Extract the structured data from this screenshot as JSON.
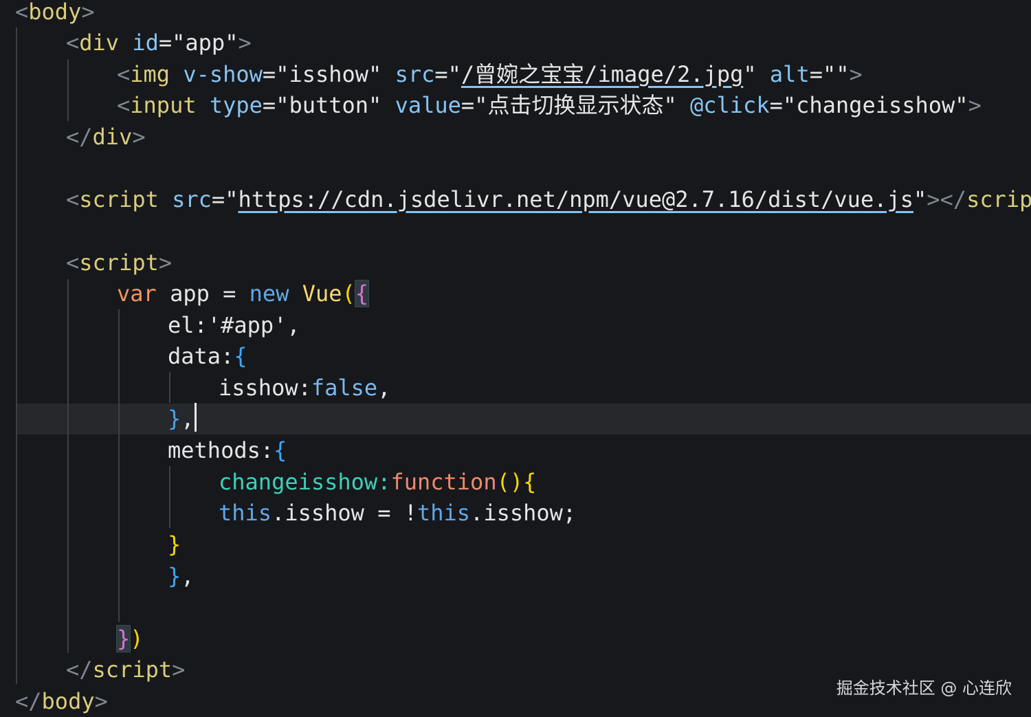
{
  "watermark": "掘金技术社区 @ 心连欣",
  "code": {
    "body_open_tag": "body",
    "div_tag": "div",
    "div_attr_id": "id",
    "div_id_value": "\"app\"",
    "img_tag": "img",
    "img_attr_vshow": "v-show",
    "img_vshow_value": "\"isshow\"",
    "img_attr_src": "src",
    "img_src_q1": "\"",
    "img_src_value": "/曾婉之宝宝/image/2.jpg",
    "img_src_q2": "\"",
    "img_attr_alt": "alt",
    "img_alt_value": "\"\"",
    "input_tag": "input",
    "input_attr_type": "type",
    "input_type_value": "\"button\"",
    "input_attr_value": "value",
    "input_value_value": "\"点击切换显示状态\"",
    "input_attr_click": "@click",
    "input_click_value": "\"changeisshow\"",
    "div_close_tag": "div",
    "script1_tag": "script",
    "script1_attr_src": "src",
    "script1_src_q1": "\"",
    "script1_src_value": "https://cdn.jsdelivr.net/npm/vue@2.7.16/dist/vue.js",
    "script1_src_q2": "\"",
    "script1_close_tag": "script",
    "script2_tag": "script",
    "kw_var": "var",
    "id_app": "app",
    "op_assign": "=",
    "kw_new": "new",
    "cls_vue": "Vue",
    "paren_open": "(",
    "brace_open": "{",
    "prop_el": "el:",
    "val_el": "'#app'",
    "comma": ",",
    "prop_data": "data:",
    "data_brace_open": "{",
    "prop_isshow": "isshow:",
    "val_false": "false",
    "comma2": ",",
    "data_brace_close": "}",
    "comma3": ",",
    "prop_methods": "methods:",
    "methods_brace_open": "{",
    "fn_name": "changeisshow",
    "colon": ":",
    "kw_function": "function",
    "fn_parens": "()",
    "fn_brace_open": "{",
    "kw_this1": "this",
    "member1": ".isshow",
    "op_assign2": "=",
    "op_not": "!",
    "kw_this2": "this",
    "member2": ".isshow;",
    "fn_brace_close": "}",
    "methods_brace_close": "}",
    "comma4": ",",
    "obj_brace_close": "}",
    "paren_close": ")",
    "script2_close_tag": "script",
    "body_close_tag": "body"
  },
  "colors": {
    "background": "#16181b",
    "current_line": "#26282c",
    "tag": "#dccd79",
    "attribute": "#86c4f3",
    "keyword_var": "#f2965f",
    "keyword_new": "#5fa8ea",
    "method_name": "#3ad1bd"
  }
}
